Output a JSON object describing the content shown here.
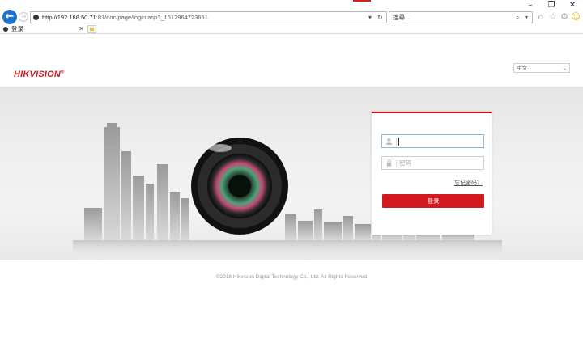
{
  "browser": {
    "window_controls": {
      "minimize": "–",
      "maximize": "❐",
      "close": "✕"
    },
    "address": {
      "url_host": "http://192.168.50.71",
      "url_rest": ":81/doc/page/login.asp?_1612964723651"
    },
    "search": {
      "placeholder": "搜尋..."
    },
    "tab": {
      "title": "登录"
    },
    "toolbar_icons": [
      "home-icon",
      "star-icon",
      "gear-icon",
      "smiley-icon"
    ]
  },
  "page": {
    "logo": "HIKVISION",
    "logo_mark": "®",
    "language": {
      "selected": "中文"
    },
    "login": {
      "username_placeholder": "",
      "password_placeholder": "密码",
      "forgot_password": "忘记密码？",
      "login_button": "登录"
    },
    "footer": "©2018 Hikvision Digital Technology Co., Ltd. All Rights Reserved"
  },
  "colors": {
    "brand_red": "#c8161d",
    "button_red": "#d3191f",
    "ie_blue": "#1f73c8"
  }
}
